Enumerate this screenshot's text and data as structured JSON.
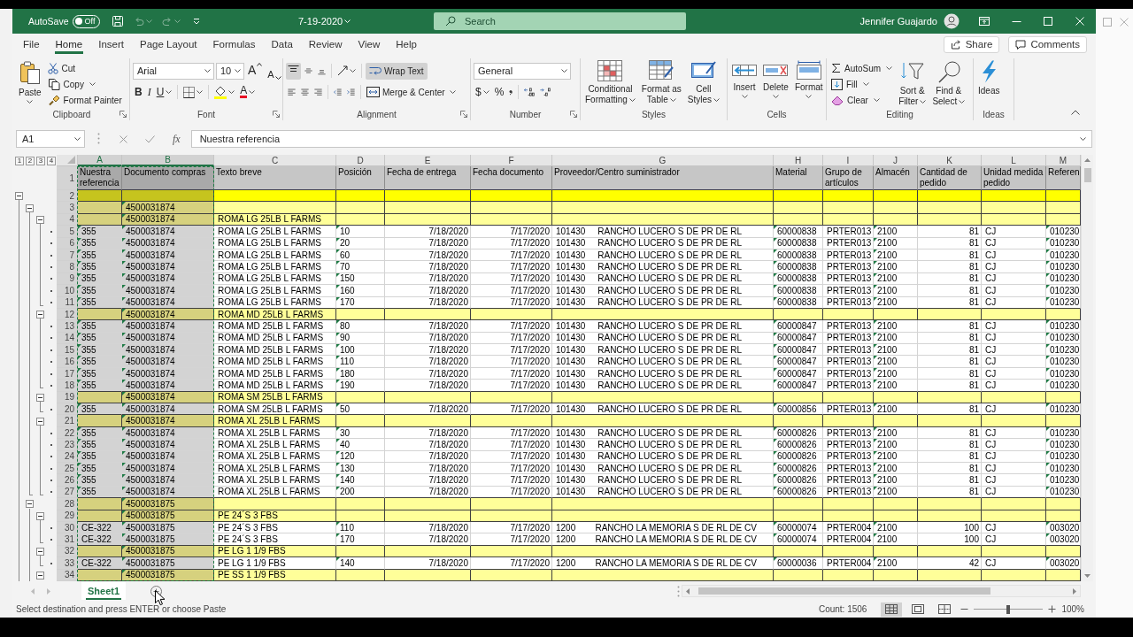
{
  "window": {
    "autosave_label": "AutoSave",
    "autosave": {
      "on": false,
      "label": "Off"
    },
    "title": "7-19-2020",
    "search": {
      "placeholder": "Search"
    },
    "user": "Jennifer Guajardo"
  },
  "tabs": [
    {
      "label": "File",
      "selected": false
    },
    {
      "label": "Home",
      "selected": true
    },
    {
      "label": "Insert",
      "selected": false
    },
    {
      "label": "Page Layout",
      "selected": false
    },
    {
      "label": "Formulas",
      "selected": false
    },
    {
      "label": "Data",
      "selected": false
    },
    {
      "label": "Review",
      "selected": false
    },
    {
      "label": "View",
      "selected": false
    },
    {
      "label": "Help",
      "selected": false
    }
  ],
  "share": "Share",
  "comments": "Comments",
  "ribbon": {
    "clipboard": {
      "label": "Clipboard",
      "paste": "Paste",
      "cut": "Cut",
      "copy": "Copy",
      "format_painter": "Format Painter"
    },
    "font": {
      "label": "Font",
      "name": "Arial",
      "size": "10",
      "grow": "A",
      "shrink": "A",
      "bold": "B",
      "italic": "I",
      "underline": "U",
      "font_color_button": "A"
    },
    "alignment": {
      "label": "Alignment",
      "top_align": {
        "on": true
      },
      "wrap_text": {
        "label": "Wrap Text",
        "on": true
      },
      "merge": "Merge & Center"
    },
    "number": {
      "label": "Number",
      "format": "General",
      "currency": "$",
      "percent": "%"
    },
    "styles": {
      "label": "Styles",
      "buttons": [
        {
          "kind": "conditional",
          "lines": [
            "Conditional",
            "Formatting"
          ]
        },
        {
          "kind": "table",
          "lines": [
            "Format as",
            "Table"
          ]
        },
        {
          "kind": "cell_styles",
          "lines": [
            "Cell",
            "Styles"
          ]
        }
      ]
    },
    "cells": {
      "label": "Cells",
      "buttons": [
        {
          "kind": "insert",
          "label": "Insert"
        },
        {
          "kind": "delete",
          "label": "Delete"
        },
        {
          "kind": "format",
          "label": "Format"
        }
      ]
    },
    "editing": {
      "label": "Editing",
      "autosum": "AutoSum",
      "fill": "Fill",
      "clear": "Clear",
      "sort": [
        "Sort &",
        "Filter"
      ],
      "find": [
        "Find &",
        "Select"
      ]
    },
    "ideas": {
      "label": "Ideas",
      "button": "Ideas"
    }
  },
  "formula_bar": {
    "name_box": "A1",
    "function_label": "fx",
    "value": "Nuestra referencia"
  },
  "outline_levels": [
    "1",
    "2",
    "3",
    "4"
  ],
  "columns": [
    {
      "letter": "A",
      "selected": true,
      "copied": true,
      "flagged": true
    },
    {
      "letter": "B",
      "selected": true,
      "copied": true,
      "flagged": true
    },
    {
      "letter": "C",
      "selected": false,
      "copied": false,
      "flagged": false
    },
    {
      "letter": "D",
      "selected": false,
      "copied": false,
      "flagged": true
    },
    {
      "letter": "E",
      "selected": false,
      "copied": false,
      "flagged": false
    },
    {
      "letter": "F",
      "selected": false,
      "copied": false,
      "flagged": false
    },
    {
      "letter": "G",
      "selected": false,
      "copied": false,
      "flagged": false
    },
    {
      "letter": "H",
      "selected": false,
      "copied": false,
      "flagged": true
    },
    {
      "letter": "I",
      "selected": false,
      "copied": false,
      "flagged": false
    },
    {
      "letter": "J",
      "selected": false,
      "copied": false,
      "flagged": true
    },
    {
      "letter": "K",
      "selected": false,
      "copied": false,
      "flagged": false
    },
    {
      "letter": "L",
      "selected": false,
      "copied": false,
      "flagged": false
    },
    {
      "letter": "M",
      "selected": false,
      "copied": false,
      "flagged": true
    }
  ],
  "rows": [
    {
      "number": "1",
      "kind": "header",
      "cells": [
        "Nuestra referencia",
        "Documento compras",
        "Texto breve",
        "Posición",
        "Fecha de entrega",
        "Fecha documento",
        "Proveedor/Centro suministrador",
        "Material",
        "Grupo de artículos",
        "Almacén",
        "Cantidad de pedido",
        "Unidad medida pedido",
        "Referen"
      ]
    },
    {
      "number": "2",
      "kind": "total",
      "expanded": true,
      "cells": [
        null,
        null,
        null,
        null,
        null,
        null,
        null,
        null,
        null,
        null,
        null,
        null,
        null
      ],
      "children": [
        {
          "number": "3",
          "kind": "subtotal",
          "expanded": true,
          "cells": [
            null,
            "4500031874",
            null,
            null,
            null,
            null,
            null,
            null,
            null,
            null,
            null,
            null,
            null
          ],
          "children": [
            {
              "number": "4",
              "kind": "subtotal",
              "expanded": true,
              "cells": [
                null,
                "4500031874",
                "ROMA LG 25LB L FARMS",
                null,
                null,
                null,
                null,
                null,
                null,
                null,
                null,
                null,
                null
              ],
              "children": [
                {
                  "number": "5",
                  "kind": "detail",
                  "ref_flagged": true,
                  "cells": [
                    "355",
                    "4500031874",
                    "ROMA LG 25LB L FARMS",
                    "10",
                    "7/18/2020",
                    "7/17/2020",
                    "101430     RANCHO LUCERO S DE PR DE RL",
                    "60000838",
                    "PRTER013",
                    "2100",
                    "81",
                    "CJ",
                    "010230"
                  ]
                },
                {
                  "number": "6",
                  "kind": "detail",
                  "ref_flagged": true,
                  "cells": [
                    "355",
                    "4500031874",
                    "ROMA LG 25LB L FARMS",
                    "20",
                    "7/18/2020",
                    "7/17/2020",
                    "101430     RANCHO LUCERO S DE PR DE RL",
                    "60000838",
                    "PRTER013",
                    "2100",
                    "81",
                    "CJ",
                    "010230"
                  ]
                },
                {
                  "number": "7",
                  "kind": "detail",
                  "ref_flagged": true,
                  "cells": [
                    "355",
                    "4500031874",
                    "ROMA LG 25LB L FARMS",
                    "60",
                    "7/18/2020",
                    "7/17/2020",
                    "101430     RANCHO LUCERO S DE PR DE RL",
                    "60000838",
                    "PRTER013",
                    "2100",
                    "81",
                    "CJ",
                    "010230"
                  ]
                },
                {
                  "number": "8",
                  "kind": "detail",
                  "ref_flagged": true,
                  "cells": [
                    "355",
                    "4500031874",
                    "ROMA LG 25LB L FARMS",
                    "70",
                    "7/18/2020",
                    "7/17/2020",
                    "101430     RANCHO LUCERO S DE PR DE RL",
                    "60000838",
                    "PRTER013",
                    "2100",
                    "81",
                    "CJ",
                    "010230"
                  ]
                },
                {
                  "number": "9",
                  "kind": "detail",
                  "ref_flagged": true,
                  "cells": [
                    "355",
                    "4500031874",
                    "ROMA LG 25LB L FARMS",
                    "150",
                    "7/18/2020",
                    "7/17/2020",
                    "101430     RANCHO LUCERO S DE PR DE RL",
                    "60000838",
                    "PRTER013",
                    "2100",
                    "81",
                    "CJ",
                    "010230"
                  ]
                },
                {
                  "number": "10",
                  "kind": "detail",
                  "ref_flagged": true,
                  "cells": [
                    "355",
                    "4500031874",
                    "ROMA LG 25LB L FARMS",
                    "160",
                    "7/18/2020",
                    "7/17/2020",
                    "101430     RANCHO LUCERO S DE PR DE RL",
                    "60000838",
                    "PRTER013",
                    "2100",
                    "81",
                    "CJ",
                    "010230"
                  ]
                },
                {
                  "number": "11",
                  "kind": "detail",
                  "ref_flagged": true,
                  "cells": [
                    "355",
                    "4500031874",
                    "ROMA LG 25LB L FARMS",
                    "170",
                    "7/18/2020",
                    "7/17/2020",
                    "101430     RANCHO LUCERO S DE PR DE RL",
                    "60000838",
                    "PRTER013",
                    "2100",
                    "81",
                    "CJ",
                    "010230"
                  ]
                }
              ]
            },
            {
              "number": "12",
              "kind": "subtotal",
              "expanded": true,
              "cells": [
                null,
                "4500031874",
                "ROMA MD 25LB L FARMS",
                null,
                null,
                null,
                null,
                null,
                null,
                null,
                null,
                null,
                null
              ],
              "children": [
                {
                  "number": "13",
                  "kind": "detail",
                  "ref_flagged": true,
                  "cells": [
                    "355",
                    "4500031874",
                    "ROMA MD 25LB L FARMS",
                    "80",
                    "7/18/2020",
                    "7/17/2020",
                    "101430     RANCHO LUCERO S DE PR DE RL",
                    "60000847",
                    "PRTER013",
                    "2100",
                    "81",
                    "CJ",
                    "010230"
                  ]
                },
                {
                  "number": "14",
                  "kind": "detail",
                  "ref_flagged": true,
                  "cells": [
                    "355",
                    "4500031874",
                    "ROMA MD 25LB L FARMS",
                    "90",
                    "7/18/2020",
                    "7/17/2020",
                    "101430     RANCHO LUCERO S DE PR DE RL",
                    "60000847",
                    "PRTER013",
                    "2100",
                    "81",
                    "CJ",
                    "010230"
                  ]
                },
                {
                  "number": "15",
                  "kind": "detail",
                  "ref_flagged": true,
                  "cells": [
                    "355",
                    "4500031874",
                    "ROMA MD 25LB L FARMS",
                    "100",
                    "7/18/2020",
                    "7/17/2020",
                    "101430     RANCHO LUCERO S DE PR DE RL",
                    "60000847",
                    "PRTER013",
                    "2100",
                    "81",
                    "CJ",
                    "010230"
                  ]
                },
                {
                  "number": "16",
                  "kind": "detail",
                  "ref_flagged": true,
                  "cells": [
                    "355",
                    "4500031874",
                    "ROMA MD 25LB L FARMS",
                    "110",
                    "7/18/2020",
                    "7/17/2020",
                    "101430     RANCHO LUCERO S DE PR DE RL",
                    "60000847",
                    "PRTER013",
                    "2100",
                    "81",
                    "CJ",
                    "010230"
                  ]
                },
                {
                  "number": "17",
                  "kind": "detail",
                  "ref_flagged": true,
                  "cells": [
                    "355",
                    "4500031874",
                    "ROMA MD 25LB L FARMS",
                    "180",
                    "7/18/2020",
                    "7/17/2020",
                    "101430     RANCHO LUCERO S DE PR DE RL",
                    "60000847",
                    "PRTER013",
                    "2100",
                    "81",
                    "CJ",
                    "010230"
                  ]
                },
                {
                  "number": "18",
                  "kind": "detail",
                  "ref_flagged": true,
                  "cells": [
                    "355",
                    "4500031874",
                    "ROMA MD 25LB L FARMS",
                    "190",
                    "7/18/2020",
                    "7/17/2020",
                    "101430     RANCHO LUCERO S DE PR DE RL",
                    "60000847",
                    "PRTER013",
                    "2100",
                    "81",
                    "CJ",
                    "010230"
                  ]
                }
              ]
            },
            {
              "number": "19",
              "kind": "subtotal",
              "expanded": true,
              "cells": [
                null,
                "4500031874",
                "ROMA SM 25LB L FARMS",
                null,
                null,
                null,
                null,
                null,
                null,
                null,
                null,
                null,
                null
              ],
              "children": [
                {
                  "number": "20",
                  "kind": "detail",
                  "ref_flagged": true,
                  "cells": [
                    "355",
                    "4500031874",
                    "ROMA SM 25LB L FARMS",
                    "50",
                    "7/18/2020",
                    "7/17/2020",
                    "101430     RANCHO LUCERO S DE PR DE RL",
                    "60000856",
                    "PRTER013",
                    "2100",
                    "81",
                    "CJ",
                    "010230"
                  ]
                }
              ]
            },
            {
              "number": "21",
              "kind": "subtotal",
              "expanded": true,
              "cells": [
                null,
                "4500031874",
                "ROMA XL 25LB L FARMS",
                null,
                null,
                null,
                null,
                null,
                null,
                null,
                null,
                null,
                null
              ],
              "children": [
                {
                  "number": "22",
                  "kind": "detail",
                  "ref_flagged": true,
                  "cells": [
                    "355",
                    "4500031874",
                    "ROMA XL 25LB L FARMS",
                    "30",
                    "7/18/2020",
                    "7/17/2020",
                    "101430     RANCHO LUCERO S DE PR DE RL",
                    "60000826",
                    "PRTER013",
                    "2100",
                    "81",
                    "CJ",
                    "010230"
                  ]
                },
                {
                  "number": "23",
                  "kind": "detail",
                  "ref_flagged": true,
                  "cells": [
                    "355",
                    "4500031874",
                    "ROMA XL 25LB L FARMS",
                    "40",
                    "7/18/2020",
                    "7/17/2020",
                    "101430     RANCHO LUCERO S DE PR DE RL",
                    "60000826",
                    "PRTER013",
                    "2100",
                    "81",
                    "CJ",
                    "010230"
                  ]
                },
                {
                  "number": "24",
                  "kind": "detail",
                  "ref_flagged": true,
                  "cells": [
                    "355",
                    "4500031874",
                    "ROMA XL 25LB L FARMS",
                    "120",
                    "7/18/2020",
                    "7/17/2020",
                    "101430     RANCHO LUCERO S DE PR DE RL",
                    "60000826",
                    "PRTER013",
                    "2100",
                    "81",
                    "CJ",
                    "010230"
                  ]
                },
                {
                  "number": "25",
                  "kind": "detail",
                  "ref_flagged": true,
                  "cells": [
                    "355",
                    "4500031874",
                    "ROMA XL 25LB L FARMS",
                    "130",
                    "7/18/2020",
                    "7/17/2020",
                    "101430     RANCHO LUCERO S DE PR DE RL",
                    "60000826",
                    "PRTER013",
                    "2100",
                    "81",
                    "CJ",
                    "010230"
                  ]
                },
                {
                  "number": "26",
                  "kind": "detail",
                  "ref_flagged": true,
                  "cells": [
                    "355",
                    "4500031874",
                    "ROMA XL 25LB L FARMS",
                    "140",
                    "7/18/2020",
                    "7/17/2020",
                    "101430     RANCHO LUCERO S DE PR DE RL",
                    "60000826",
                    "PRTER013",
                    "2100",
                    "81",
                    "CJ",
                    "010230"
                  ]
                },
                {
                  "number": "27",
                  "kind": "detail",
                  "ref_flagged": true,
                  "cells": [
                    "355",
                    "4500031874",
                    "ROMA XL 25LB L FARMS",
                    "200",
                    "7/18/2020",
                    "7/17/2020",
                    "101430     RANCHO LUCERO S DE PR DE RL",
                    "60000826",
                    "PRTER013",
                    "2100",
                    "81",
                    "CJ",
                    "010230"
                  ]
                }
              ]
            }
          ]
        },
        {
          "number": "28",
          "kind": "subtotal",
          "expanded": true,
          "cells": [
            null,
            "4500031875",
            null,
            null,
            null,
            null,
            null,
            null,
            null,
            null,
            null,
            null,
            null
          ],
          "children": [
            {
              "number": "29",
              "kind": "subtotal",
              "expanded": true,
              "cells": [
                null,
                "4500031875",
                "PE 24´S 3 FBS",
                null,
                null,
                null,
                null,
                null,
                null,
                null,
                null,
                null,
                null
              ],
              "children": [
                {
                  "number": "30",
                  "kind": "detail",
                  "ref_flagged": false,
                  "cells": [
                    "CE-322",
                    "4500031875",
                    "PE 24´S 3 FBS",
                    "110",
                    "7/18/2020",
                    "7/17/2020",
                    "1200        RANCHO LA MEMORIA S DE RL DE CV",
                    "60000074",
                    "PRTER004",
                    "2100",
                    "100",
                    "CJ",
                    "003020"
                  ]
                },
                {
                  "number": "31",
                  "kind": "detail",
                  "ref_flagged": false,
                  "cells": [
                    "CE-322",
                    "4500031875",
                    "PE 24´S 3 FBS",
                    "170",
                    "7/18/2020",
                    "7/17/2020",
                    "1200        RANCHO LA MEMORIA S DE RL DE CV",
                    "60000074",
                    "PRTER004",
                    "2100",
                    "100",
                    "CJ",
                    "003020"
                  ]
                }
              ]
            },
            {
              "number": "32",
              "kind": "subtotal",
              "expanded": true,
              "cells": [
                null,
                "4500031875",
                "PE LG 1 1/9 FBS",
                null,
                null,
                null,
                null,
                null,
                null,
                null,
                null,
                null,
                null
              ],
              "children": [
                {
                  "number": "33",
                  "kind": "detail",
                  "ref_flagged": false,
                  "cells": [
                    "CE-322",
                    "4500031875",
                    "PE LG 1 1/9 FBS",
                    "140",
                    "7/18/2020",
                    "7/17/2020",
                    "1200        RANCHO LA MEMORIA S DE RL DE CV",
                    "60000036",
                    "PRTER004",
                    "2100",
                    "42",
                    "CJ",
                    "003020"
                  ]
                }
              ]
            },
            {
              "number": "34",
              "kind": "subtotal",
              "expanded": true,
              "cells": [
                null,
                "4500031875",
                "PE SS 1 1/9 FBS",
                null,
                null,
                null,
                null,
                null,
                null,
                null,
                null,
                null,
                null
              ]
            }
          ]
        }
      ]
    }
  ],
  "sheets": [
    {
      "label": "Sheet1",
      "selected": true
    }
  ],
  "status": {
    "message": "Select destination and press ENTER or choose Paste",
    "count": "Count: 1506",
    "views": [
      {
        "kind": "normal",
        "selected": true
      },
      {
        "kind": "page_layout",
        "selected": false
      },
      {
        "kind": "page_break",
        "selected": false
      }
    ],
    "zoom": {
      "level": 0.5,
      "label": "100%"
    }
  }
}
